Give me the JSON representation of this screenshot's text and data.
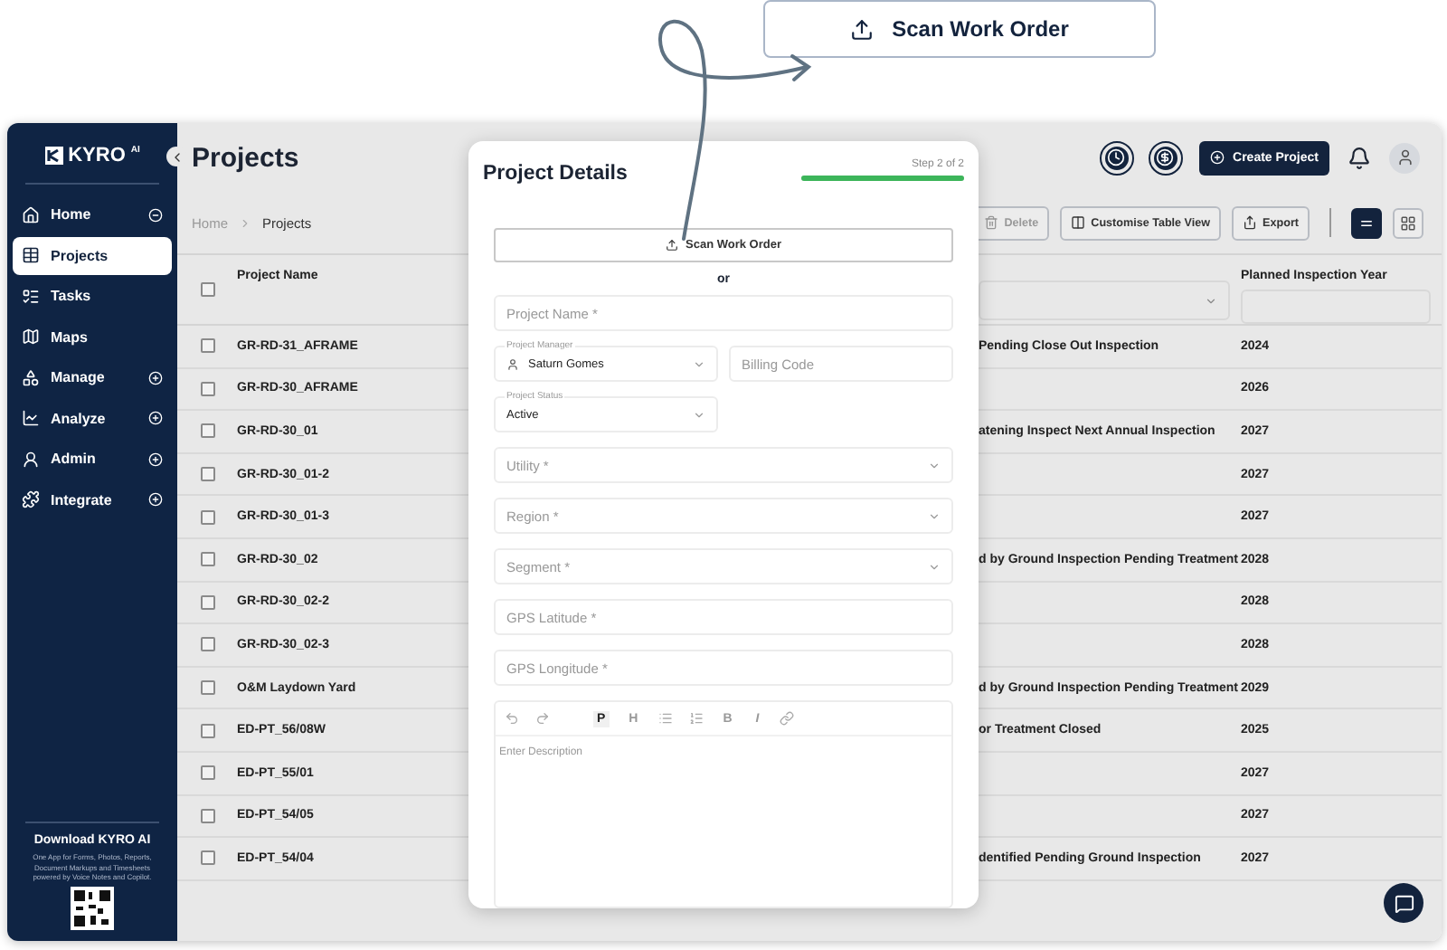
{
  "callout": {
    "label": "Scan Work Order"
  },
  "sidebar": {
    "brand": "KYRO",
    "brand_badge": "AI",
    "items": [
      {
        "label": "Home",
        "kind": "home",
        "selected": false,
        "expanded": true
      },
      {
        "label": "Projects",
        "kind": "projects",
        "selected": true
      },
      {
        "label": "Tasks",
        "kind": "tasks",
        "selected": false
      },
      {
        "label": "Maps",
        "kind": "maps",
        "selected": false
      },
      {
        "label": "Manage",
        "kind": "manage",
        "selected": false,
        "expanded": false
      },
      {
        "label": "Analyze",
        "kind": "analyze",
        "selected": false,
        "expanded": false
      },
      {
        "label": "Admin",
        "kind": "admin",
        "selected": false,
        "expanded": false
      },
      {
        "label": "Integrate",
        "kind": "integrate",
        "selected": false,
        "expanded": false
      }
    ],
    "promo": {
      "title": "Download KYRO AI",
      "text": "One App for Forms, Photos, Reports, Document Markups and Timesheets powered by Voice Notes and Copilot."
    }
  },
  "header": {
    "title": "Projects",
    "create_button": "Create Project"
  },
  "breadcrumb": [
    "Home",
    "Projects"
  ],
  "toolbar": {
    "buttons": [
      {
        "label": "Delete",
        "kind": "delete",
        "disabled": true
      },
      {
        "label": "Customise Table View",
        "kind": "columns",
        "disabled": false
      },
      {
        "label": "Export",
        "kind": "export",
        "disabled": false
      }
    ],
    "views": [
      {
        "kind": "list",
        "selected": true
      },
      {
        "kind": "grid",
        "selected": false
      }
    ]
  },
  "table": {
    "columns": [
      "Project Name",
      "Planned Inspection Year"
    ],
    "select_all_checked": false,
    "rows": [
      {
        "name": "GR-RD-31_AFRAME",
        "status": "Pending Close Out Inspection",
        "year": "2024",
        "checked": false
      },
      {
        "name": "GR-RD-30_AFRAME",
        "year": "2026",
        "checked": false
      },
      {
        "name": "GR-RD-30_01",
        "status": "atening Inspect Next Annual Inspection",
        "year": "2027",
        "checked": false
      },
      {
        "name": "GR-RD-30_01-2",
        "year": "2027",
        "checked": false
      },
      {
        "name": "GR-RD-30_01-3",
        "year": "2027",
        "checked": false
      },
      {
        "name": "GR-RD-30_02",
        "status": "d by Ground Inspection Pending Treatment",
        "year": "2028",
        "checked": false
      },
      {
        "name": "GR-RD-30_02-2",
        "year": "2028",
        "checked": false
      },
      {
        "name": "GR-RD-30_02-3",
        "year": "2028",
        "checked": false
      },
      {
        "name": "O&M Laydown Yard",
        "status": "d by Ground Inspection Pending Treatment",
        "year": "2029",
        "checked": false
      },
      {
        "name": "ED-PT_56/08W",
        "status": "or Treatment Closed",
        "year": "2025",
        "checked": false
      },
      {
        "name": "ED-PT_55/01",
        "year": "2027",
        "checked": false
      },
      {
        "name": "ED-PT_54/05",
        "year": "2027",
        "checked": false
      },
      {
        "name": "ED-PT_54/04",
        "status": "dentified Pending Ground Inspection",
        "year": "2027",
        "checked": false
      }
    ]
  },
  "modal": {
    "title": "Project Details",
    "step": "Step 2 of 2",
    "progress": {
      "level": 1
    },
    "scan_button": "Scan Work Order",
    "separator": "or",
    "project_name": {
      "placeholder": "Project Name *"
    },
    "manager": {
      "label": "Project Manager",
      "value": "Saturn Gomes"
    },
    "billing_code": {
      "placeholder": "Billing Code"
    },
    "status": {
      "label": "Project Status",
      "value": "Active"
    },
    "location_fields": [
      {
        "kind": "select",
        "placeholder": "Utility *"
      },
      {
        "kind": "select",
        "placeholder": "Region *"
      },
      {
        "kind": "select",
        "placeholder": "Segment *"
      },
      {
        "kind": "text",
        "placeholder": "GPS Latitude *"
      },
      {
        "kind": "text",
        "placeholder": "GPS Longitude *"
      }
    ],
    "editor": {
      "block_buttons": [
        {
          "label": "P",
          "selected": true
        },
        {
          "label": "H",
          "selected": false
        }
      ],
      "mark_buttons": [
        {
          "label": "B",
          "selected": false
        },
        {
          "label": "I",
          "selected": false
        }
      ],
      "placeholder": "Enter Description"
    }
  }
}
